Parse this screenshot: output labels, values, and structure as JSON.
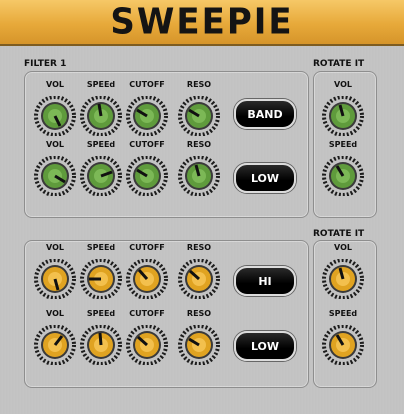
{
  "app": {
    "title": "SWEEPIE"
  },
  "sections": {
    "filter1_title": "FILTER 1",
    "rotate1_title": "ROTATE IT",
    "rotate2_title": "ROTATE IT"
  },
  "labels": {
    "vol": "VOL",
    "speed": "SPEEd",
    "cutoff": "CUTOFF",
    "reso": "RESO"
  },
  "buttons": {
    "band": "BAND",
    "low1": "LOW",
    "hi": "HI",
    "low2": "LOW"
  },
  "colors": {
    "green_knob": "#5f9b3c",
    "orange_knob": "#e0a321",
    "header": "#e7a93a"
  }
}
